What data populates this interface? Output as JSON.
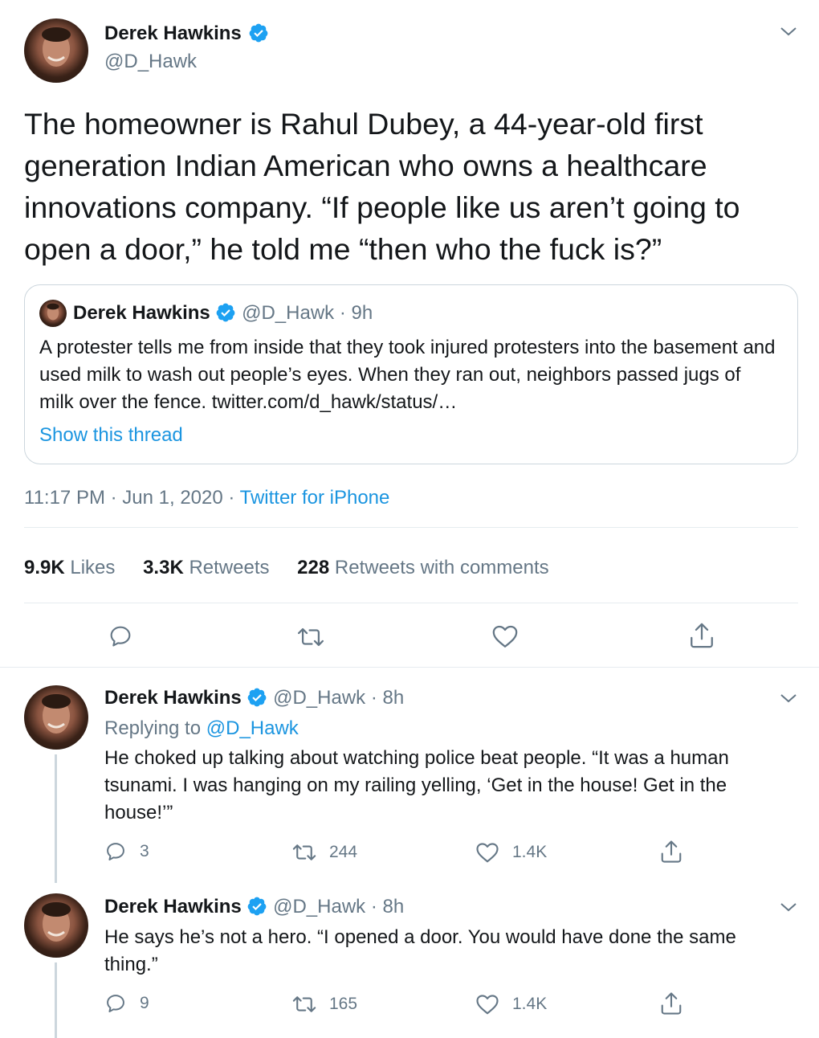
{
  "main_tweet": {
    "author_name": "Derek Hawkins",
    "handle": "@D_Hawk",
    "text": "The homeowner is Rahul Dubey, a 44-year-old first generation Indian American who owns a healthcare innovations company. “If people like us aren’t going to open a door,” he told me “then who the fuck is?”",
    "quoted": {
      "author_name": "Derek Hawkins",
      "handle": "@D_Hawk",
      "separator": "·",
      "time": "9h",
      "text": "A protester tells me from inside that they took injured protesters into the basement and used milk to wash out people’s eyes. When they ran out, neighbors passed jugs of milk over the fence. twitter.com/d_hawk/status/…",
      "show_thread": "Show this thread"
    },
    "timestamp": "11:17 PM · Jun 1, 2020 ·",
    "source": "Twitter for iPhone",
    "stats": {
      "likes_count": "9.9K",
      "likes_label": "Likes",
      "retweets_count": "3.3K",
      "retweets_label": "Retweets",
      "comments_count": "228",
      "comments_label": "Retweets with comments"
    }
  },
  "replies": [
    {
      "author_name": "Derek Hawkins",
      "handle": "@D_Hawk",
      "separator": "·",
      "time": "8h",
      "replying_prefix": "Replying to",
      "replying_handle": "@D_Hawk",
      "text": "He choked up talking about watching police beat people. “It was a human tsunami. I was hanging on my railing yelling, ‘Get in the house! Get in the house!’”",
      "reply_count": "3",
      "retweet_count": "244",
      "like_count": "1.4K"
    },
    {
      "author_name": "Derek Hawkins",
      "handle": "@D_Hawk",
      "separator": "·",
      "time": "8h",
      "text": "He says he’s not a hero. “I opened a door. You would have done the same thing.”",
      "reply_count": "9",
      "retweet_count": "165",
      "like_count": "1.4K"
    }
  ],
  "icons": [
    "verified-badge-icon",
    "chevron-down-icon",
    "reply-icon",
    "retweet-icon",
    "like-icon",
    "share-icon"
  ],
  "colors": {
    "accent": "#1b95e0",
    "verified": "#1da1f2",
    "text": "#14171a",
    "muted": "#657786",
    "border": "#e6ecf0"
  }
}
